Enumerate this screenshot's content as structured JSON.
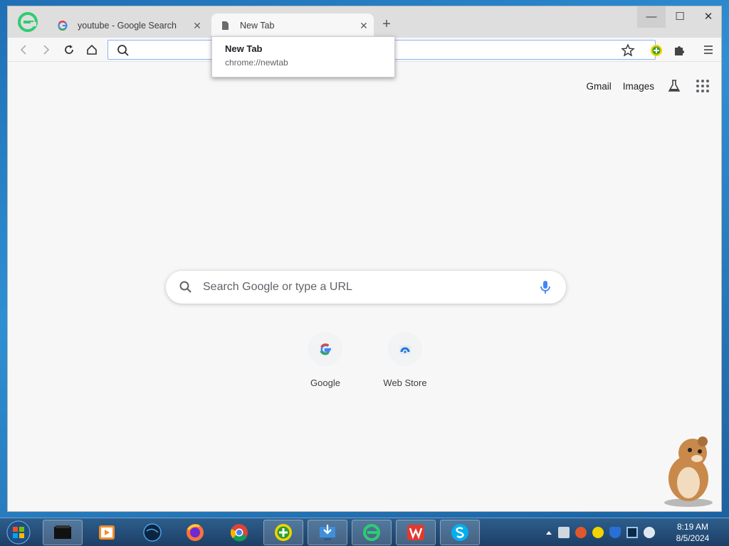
{
  "tabs": [
    {
      "label": "youtube - Google Search",
      "close": "✕"
    },
    {
      "label": "New Tab",
      "close": "✕"
    }
  ],
  "new_tab_symbol": "+",
  "window_controls": {
    "minimize": "—",
    "maximize": "☐",
    "close": "✕"
  },
  "omnibox": {
    "value": "",
    "placeholder": ""
  },
  "tooltip": {
    "title": "New Tab",
    "url": "chrome://newtab"
  },
  "top_links": {
    "gmail": "Gmail",
    "images": "Images"
  },
  "search": {
    "placeholder": "Search Google or type a URL"
  },
  "shortcuts": [
    {
      "label": "Google",
      "icon": "google-g-icon"
    },
    {
      "label": "Web Store",
      "icon": "web-store-icon"
    }
  ],
  "clock": {
    "time": "8:19 AM",
    "date": "8/5/2024"
  },
  "colors": {
    "accent": "#1a73e8",
    "taskbar": "#2d5e8c",
    "app_logo": "#2ecc71"
  }
}
